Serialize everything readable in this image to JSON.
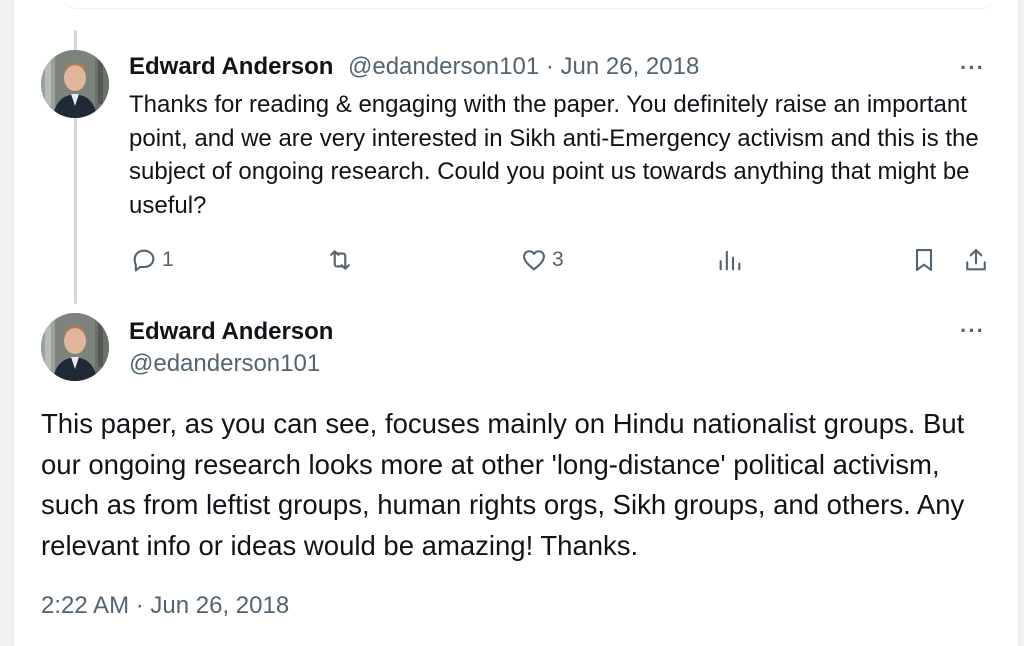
{
  "reply": {
    "author_name": "Edward Anderson",
    "handle": "@edanderson101",
    "separator": "·",
    "date": "Jun 26, 2018",
    "text": "Thanks for reading & engaging with the paper. You definitely raise an important point, and we are very interested in Sikh anti-Emergency activism and this is the subject of ongoing research. Could you point us towards anything that might be useful?",
    "more_label": "···",
    "actions": {
      "reply_count": "1",
      "retweet_count": "",
      "like_count": "3",
      "views_count": ""
    },
    "icons": [
      "reply-icon",
      "retweet-icon",
      "like-icon",
      "views-icon",
      "bookmark-icon",
      "share-icon"
    ]
  },
  "main": {
    "author_name": "Edward Anderson",
    "handle": "@edanderson101",
    "more_label": "···",
    "text": "This paper, as you can see, focuses mainly on Hindu nationalist groups. But our ongoing research looks more at other 'long-distance' political activism, such as from leftist groups, human rights orgs, Sikh groups, and others. Any relevant info or ideas would be amazing! Thanks.",
    "timestamp": "2:22 AM · Jun 26, 2018"
  },
  "colors": {
    "text": "#0f1419",
    "secondary": "#536471",
    "thread_line": "#cfd9de",
    "background": "#ffffff"
  }
}
